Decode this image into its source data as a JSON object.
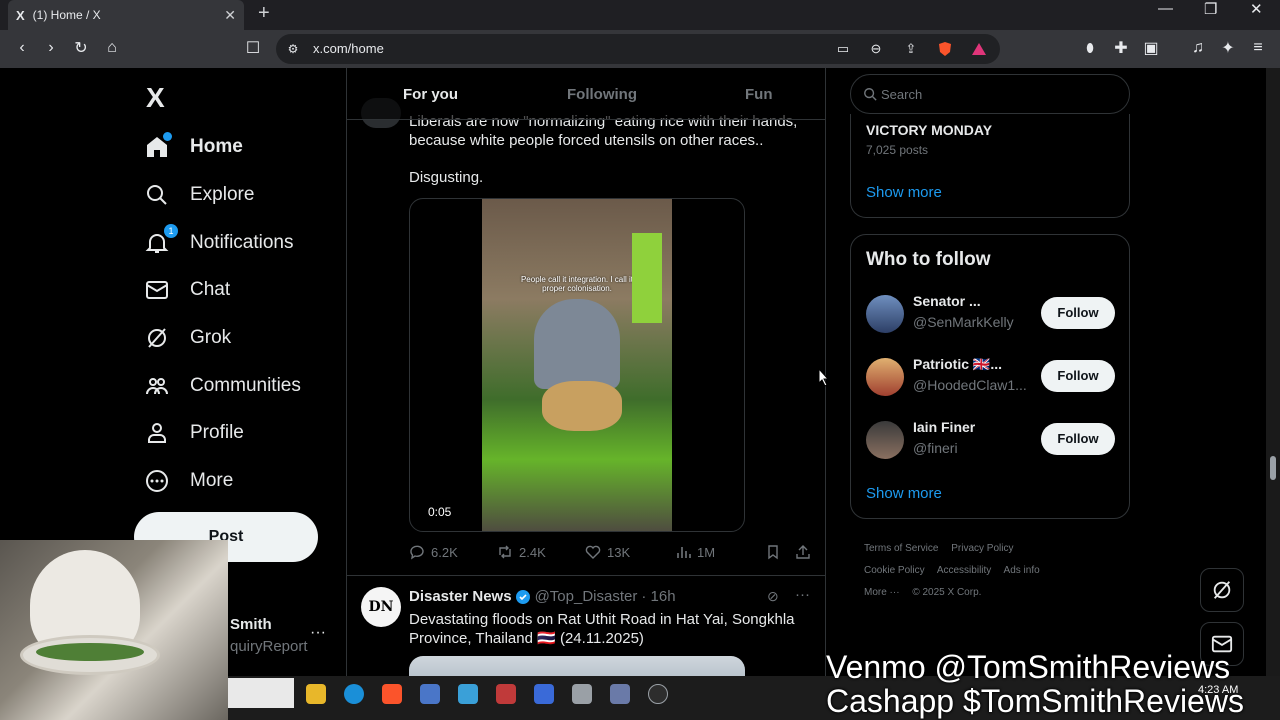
{
  "browser": {
    "tab_title": "(1) Home / X",
    "tab_logo": "X",
    "url": "x.com/home",
    "new_tab": "+"
  },
  "nav": {
    "logo": "X",
    "items": [
      {
        "label": "Home",
        "icon": "home-icon"
      },
      {
        "label": "Explore",
        "icon": "search-icon"
      },
      {
        "label": "Notifications",
        "icon": "bell-icon",
        "badge": "1"
      },
      {
        "label": "Chat",
        "icon": "mail-icon"
      },
      {
        "label": "Grok",
        "icon": "grok-icon"
      },
      {
        "label": "Communities",
        "icon": "communities-icon"
      },
      {
        "label": "Profile",
        "icon": "person-icon"
      },
      {
        "label": "More",
        "icon": "more-circle-icon"
      }
    ],
    "post_button": "Post",
    "account_name": "Smith",
    "account_handle": "quiryReport",
    "account_more": "···"
  },
  "timeline": {
    "tabs": [
      "For you",
      "Following",
      "Fun"
    ],
    "active_tab": "For you",
    "tweet1": {
      "text_partial": "Liberals are now \"normalizing\" eating rice with their hands,",
      "text_line2": "because white people forced utensils on other races..",
      "text_line3": "Disgusting.",
      "video_caption": "People call it integration. I call it proper colonisation.",
      "video_time": "0:05",
      "replies": "6.2K",
      "reposts": "2.4K",
      "likes": "13K",
      "views": "1M"
    },
    "tweet2": {
      "avatar_text": "DN",
      "name": "Disaster News",
      "handle": "@Top_Disaster",
      "time": "· 16h",
      "text": "Devastating floods on Rat Uthit Road in Hat Yai, Songkhla Province, Thailand 🇹🇭 (24.11.2025)"
    }
  },
  "sidebar": {
    "search_placeholder": "Search",
    "trend": {
      "title": "VICTORY MONDAY",
      "posts": "7,025 posts",
      "show_more": "Show more"
    },
    "who_to_follow": {
      "title": "Who to follow",
      "follow_label": "Follow",
      "show_more": "Show more",
      "accounts": [
        {
          "name": "Senator ...",
          "handle": "@SenMarkKelly"
        },
        {
          "name": "Patriotic 🇬🇧...",
          "handle": "@HoodedClaw1..."
        },
        {
          "name": "Iain Finer",
          "handle": "@fineri"
        }
      ]
    },
    "footer": [
      "Terms of Service",
      "Privacy Policy",
      "Cookie Policy",
      "Accessibility",
      "Ads info",
      "More ···",
      "© 2025 X Corp."
    ]
  },
  "overlay": {
    "line1": "Venmo @TomSmithReviews",
    "line2": "Cashapp $TomSmithReviews",
    "clock": "4:23 AM"
  },
  "colors": {
    "accent": "#1d9bf0",
    "background": "#000000",
    "text": "#e7e9ea",
    "muted": "#71767b"
  }
}
